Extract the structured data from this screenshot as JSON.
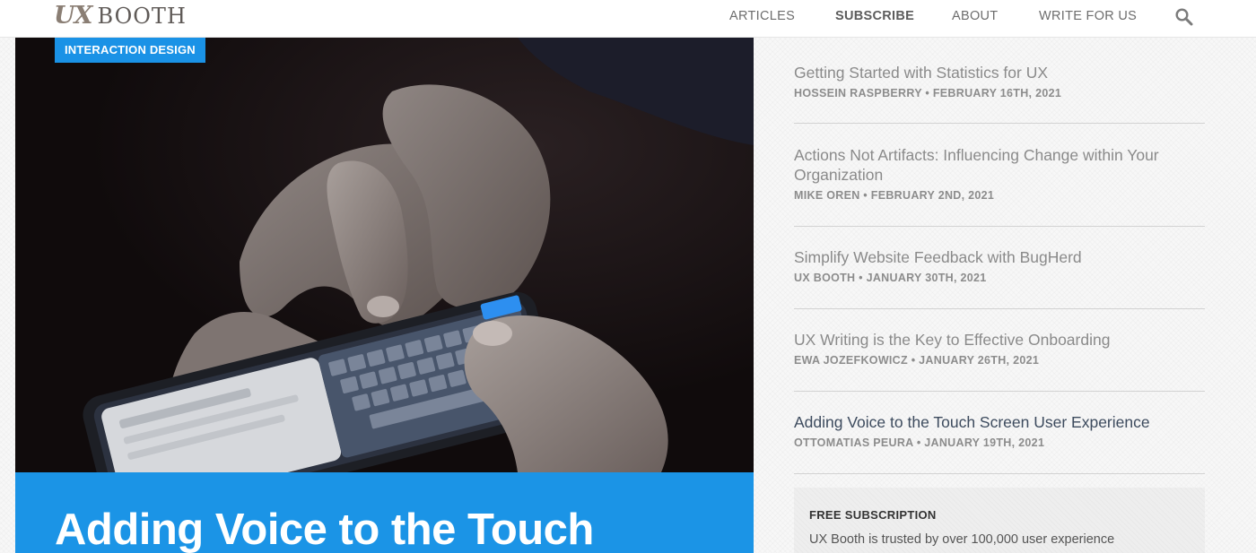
{
  "logo": {
    "ux": "UX",
    "booth": "BOOTH"
  },
  "nav": {
    "articles": "ARTICLES",
    "subscribe": "SUBSCRIBE",
    "about": "ABOUT",
    "write": "WRITE FOR US",
    "search_icon": "search-icon"
  },
  "hero": {
    "tag": "INTERACTION DESIGN",
    "title": "Adding Voice to the Touch",
    "tag_color": "#1a92e6",
    "title_bg_color": "#1b94e6"
  },
  "sidebar": {
    "posts": [
      {
        "title": "Getting Started with Statistics for UX",
        "meta": "HOSSEIN RASPBERRY • FEBRUARY 16TH, 2021"
      },
      {
        "title": "Actions Not Artifacts: Influencing Change within Your Organization",
        "meta": "MIKE OREN • FEBRUARY 2ND, 2021"
      },
      {
        "title": "Simplify Website Feedback with BugHerd",
        "meta": "UX BOOTH • JANUARY 30TH, 2021"
      },
      {
        "title": "UX Writing is the Key to Effective Onboarding",
        "meta": "EWA JOZEFKOWICZ • JANUARY 26TH, 2021"
      },
      {
        "title": "Adding Voice to the Touch Screen User Experience",
        "meta": "OTTOMATIAS PEURA • JANUARY 19TH, 2021"
      }
    ],
    "subscription": {
      "heading": "FREE SUBSCRIPTION",
      "text": "UX Booth is trusted by over 100,000 user experience"
    }
  }
}
